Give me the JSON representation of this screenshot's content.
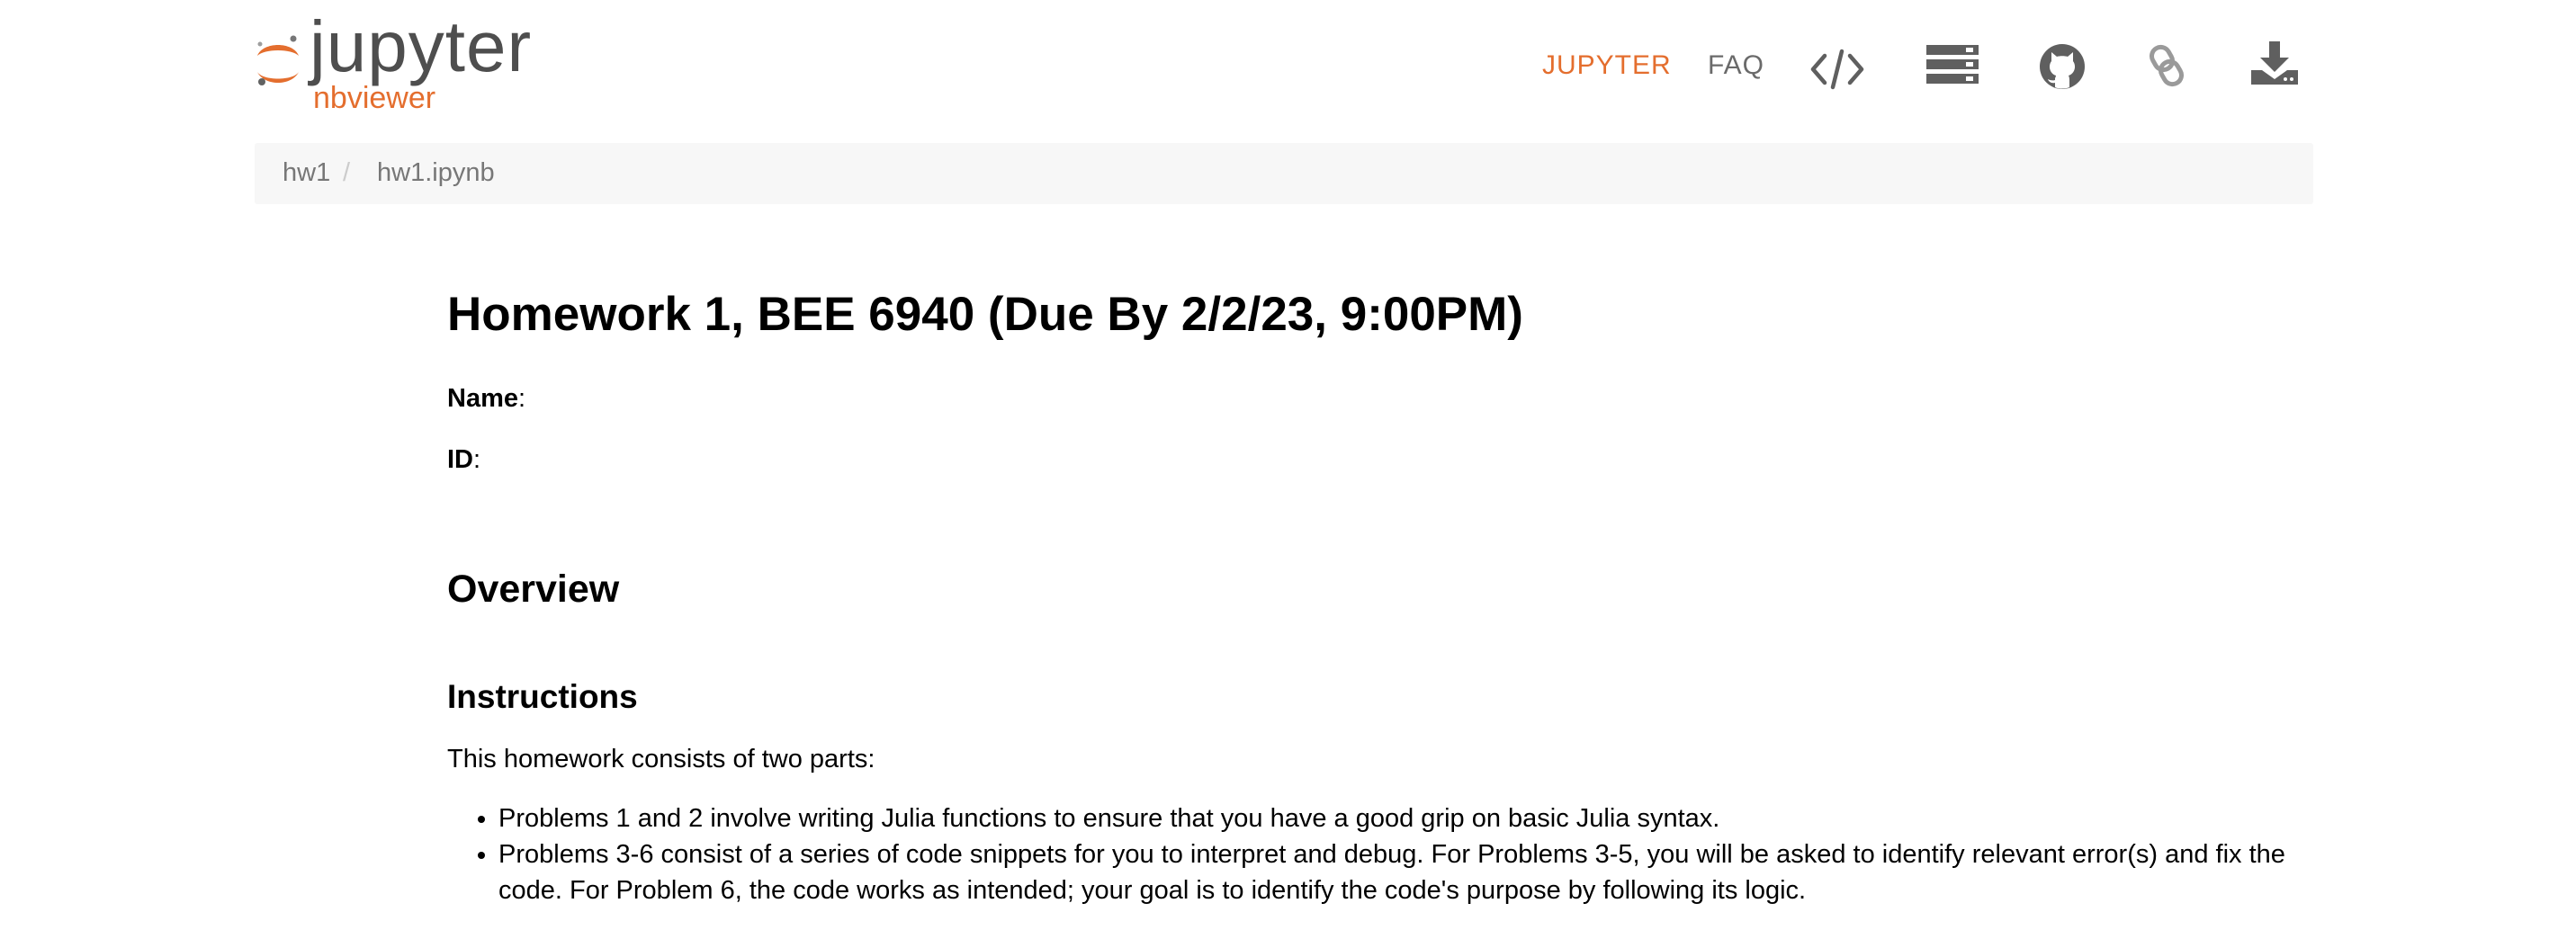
{
  "header": {
    "logo": {
      "wordmark": "jupyter",
      "subtitle": "nbviewer"
    },
    "nav": {
      "jupyter_label": "JUPYTER",
      "faq_label": "FAQ",
      "icons": [
        "code-icon",
        "server-icon",
        "github-icon",
        "link-icon",
        "download-icon"
      ]
    }
  },
  "breadcrumb": {
    "items": [
      "hw1",
      "hw1.ipynb"
    ],
    "separator": "/"
  },
  "notebook": {
    "title": "Homework 1, BEE 6940 (Due By 2/2/23, 9:00PM)",
    "name_label": "Name",
    "name_suffix": ":",
    "id_label": "ID",
    "id_suffix": ":",
    "overview_heading": "Overview",
    "instructions_heading": "Instructions",
    "intro": "This homework consists of two parts:",
    "bullets": [
      "Problems 1 and 2 involve writing Julia functions to ensure that you have a good grip on basic Julia syntax.",
      "Problems 3-6 consist of a series of code snippets for you to interpret and debug. For Problems 3-5, you will be asked to identify relevant error(s) and fix the code. For Problem 6, the code works as intended; your goal is to identify the code's purpose by following its logic."
    ]
  },
  "colors": {
    "accent": "#e46e2e",
    "icon_gray": "#5f5f5f",
    "breadcrumb_bg": "#f7f7f7"
  }
}
